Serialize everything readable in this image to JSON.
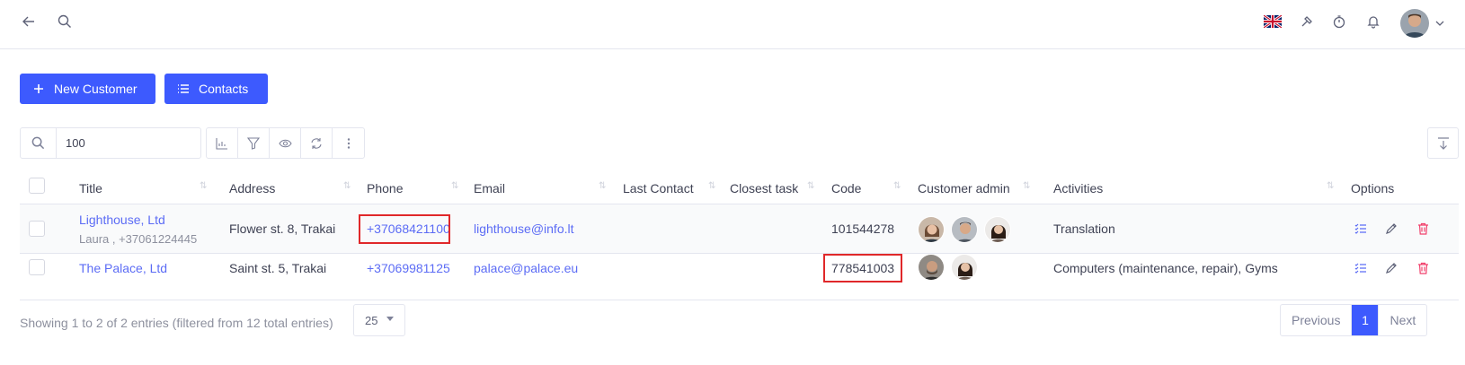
{
  "topbar": {
    "icons": [
      "back-arrow-icon",
      "search-icon",
      "uk-flag-icon",
      "hammer-icon",
      "timer-icon",
      "bell-icon"
    ]
  },
  "actions": {
    "new_customer": "New Customer",
    "contacts": "Contacts"
  },
  "search": {
    "value": "100"
  },
  "table": {
    "columns": [
      "Title",
      "Address",
      "Phone",
      "Email",
      "Last Contact",
      "Closest task",
      "Code",
      "Customer admin",
      "Activities",
      "Options"
    ],
    "rows": [
      {
        "title": "Lighthouse, Ltd",
        "contact": "Laura , +37061224445",
        "address": "Flower st. 8, Trakai",
        "phone": "+37068421100",
        "email": "lighthouse@info.lt",
        "last_contact": "",
        "closest_task": "",
        "code": "101544278",
        "activities": "Translation"
      },
      {
        "title": "The Palace, Ltd",
        "contact": "",
        "address": "Saint st. 5, Trakai",
        "phone": "+37069981125",
        "email": "palace@palace.eu",
        "last_contact": "",
        "closest_task": "",
        "code": "778541003",
        "activities": "Computers (maintenance, repair), Gyms"
      }
    ]
  },
  "footer": {
    "info": "Showing 1 to 2 of 2 entries (filtered from 12 total entries)",
    "page_size": "25",
    "previous": "Previous",
    "current_page": "1",
    "next": "Next"
  },
  "colors": {
    "primary": "#3d5afe",
    "link": "#5c6cf5",
    "highlight": "#e0282a",
    "delete": "#f1416c"
  }
}
